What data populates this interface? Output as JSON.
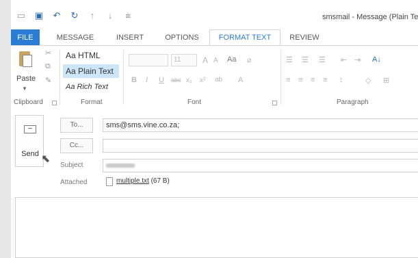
{
  "window": {
    "title": "smsmail - Message (Plain Text)"
  },
  "tabs": [
    "FILE",
    "MESSAGE",
    "INSERT",
    "OPTIONS",
    "FORMAT TEXT",
    "REVIEW"
  ],
  "ribbon": {
    "clipboard": {
      "paste_label": "Paste",
      "group_label": "Clipboard"
    },
    "format": {
      "html": "Aa HTML",
      "plain": "Aa Plain Text",
      "rich": "Aa Rich Text",
      "group_label": "Format"
    },
    "font": {
      "size": "11",
      "bold": "B",
      "italic": "I",
      "underline": "U",
      "strike": "abc",
      "sub": "x₂",
      "sup": "x²",
      "grow": "A",
      "shrink": "A",
      "case": "Aa",
      "highlight": "ab",
      "color": "A",
      "group_label": "Font"
    },
    "paragraph": {
      "group_label": "Paragraph",
      "sort": "A↓"
    }
  },
  "message": {
    "send_label": "Send",
    "to_label": "To...",
    "to_value": "sms@sms.vine.co.za;",
    "cc_label": "Cc...",
    "cc_value": "",
    "subject_label": "Subject",
    "attached_label": "Attached",
    "attachment_name": "multiple.txt",
    "attachment_size": "(67 B)"
  },
  "colors": {
    "accent": "#2b7cd3",
    "file_tab": "#2b7cd3",
    "selected": "#cde6f7"
  }
}
